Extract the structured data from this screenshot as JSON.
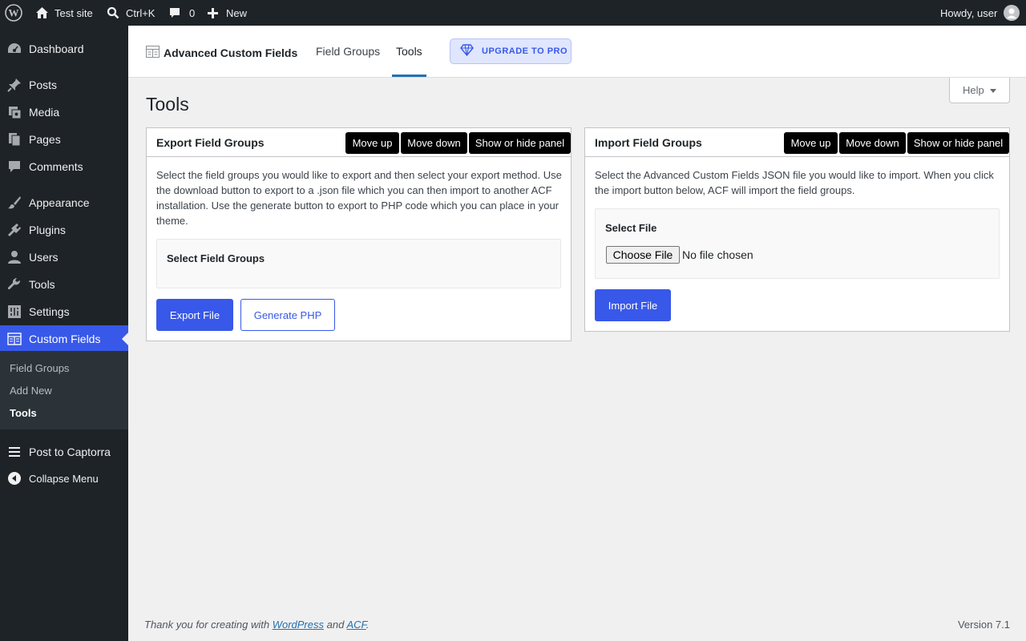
{
  "adminbar": {
    "site_name": "Test site",
    "search_shortcut": "Ctrl+K",
    "comments_count": "0",
    "new_label": "New",
    "howdy": "Howdy, user"
  },
  "sidebar": {
    "items": [
      {
        "label": "Dashboard",
        "icon": "dashboard-icon"
      },
      {
        "label": "Posts",
        "icon": "pin-icon"
      },
      {
        "label": "Media",
        "icon": "media-icon"
      },
      {
        "label": "Pages",
        "icon": "pages-icon"
      },
      {
        "label": "Comments",
        "icon": "comment-icon"
      },
      {
        "label": "Appearance",
        "icon": "brush-icon"
      },
      {
        "label": "Plugins",
        "icon": "plugin-icon"
      },
      {
        "label": "Users",
        "icon": "user-icon"
      },
      {
        "label": "Tools",
        "icon": "wrench-icon"
      },
      {
        "label": "Settings",
        "icon": "settings-icon"
      },
      {
        "label": "Custom Fields",
        "icon": "custom-fields-icon"
      }
    ],
    "submenu": [
      "Field Groups",
      "Add New",
      "Tools"
    ],
    "post_to_captorra": "Post to Captorra",
    "collapse": "Collapse Menu"
  },
  "acf_header": {
    "title": "Advanced Custom Fields",
    "tabs": [
      "Field Groups",
      "Tools"
    ],
    "active_tab": "Tools",
    "upgrade": "UPGRADE TO PRO"
  },
  "help": "Help",
  "page_title": "Tools",
  "export_panel": {
    "title": "Export Field Groups",
    "move_up": "Move up",
    "move_down": "Move down",
    "toggle": "Show or hide panel",
    "description": "Select the field groups you would like to export and then select your export method. Use the download button to export to a .json file which you can then import to another ACF installation. Use the generate button to export to PHP code which you can place in your theme.",
    "select_label": "Select Field Groups",
    "export_button": "Export File",
    "generate_button": "Generate PHP"
  },
  "import_panel": {
    "title": "Import Field Groups",
    "move_up": "Move up",
    "move_down": "Move down",
    "toggle": "Show or hide panel",
    "description": "Select the Advanced Custom Fields JSON file you would like to import. When you click the import button below, ACF will import the field groups.",
    "select_label": "Select File",
    "choose_file": "Choose File",
    "no_file": "No file chosen",
    "import_button": "Import File"
  },
  "footer": {
    "thanks_prefix": "Thank you for creating with ",
    "wordpress": "WordPress",
    "and": " and ",
    "acf": "ACF",
    "period": ".",
    "version": "Version 7.1"
  },
  "colors": {
    "accent": "#3858e9",
    "adminbar": "#1d2327",
    "background": "#f0f0f1"
  }
}
